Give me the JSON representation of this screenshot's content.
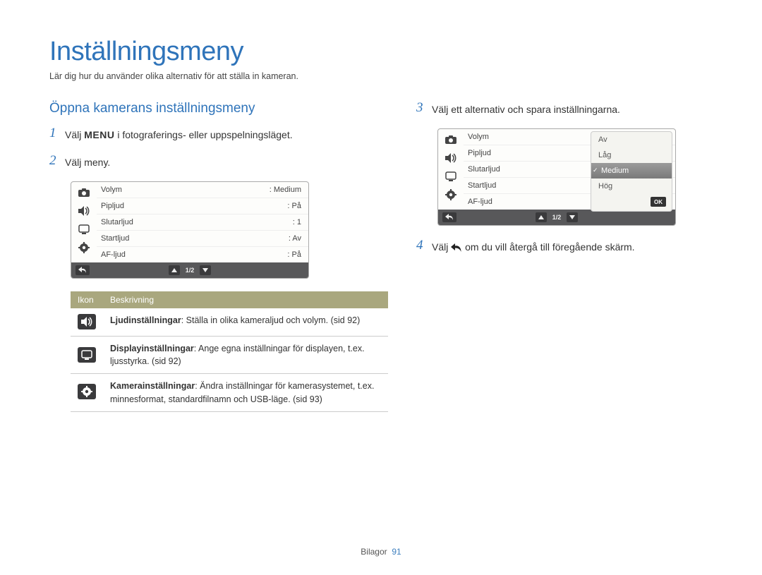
{
  "title": "Inställningsmeny",
  "subtitle": "Lär dig hur du använder olika alternativ för att ställa in kameran.",
  "section_heading": "Öppna kamerans inställningsmeny",
  "steps": {
    "s1_pre": "Välj ",
    "s1_menu": "MENU",
    "s1_post": " i fotograferings- eller uppspelningsläget.",
    "s2": "Välj meny.",
    "s3": "Välj ett alternativ och spara inställningarna.",
    "s4_pre": "Välj ",
    "s4_post": " om du vill återgå till föregående skärm."
  },
  "screen1": {
    "rows": [
      {
        "label": "Volym",
        "value": "Medium"
      },
      {
        "label": "Pipljud",
        "value": "På"
      },
      {
        "label": "Slutarljud",
        "value": "1"
      },
      {
        "label": "Startljud",
        "value": "Av"
      },
      {
        "label": "AF-ljud",
        "value": "På"
      }
    ],
    "page": "1/2"
  },
  "screen2": {
    "rows": [
      {
        "label": "Volym"
      },
      {
        "label": "Pipljud"
      },
      {
        "label": "Slutarljud"
      },
      {
        "label": "Startljud"
      },
      {
        "label": "AF-ljud"
      }
    ],
    "options": [
      "Av",
      "Låg",
      "Medium",
      "Hög"
    ],
    "selected": "Medium",
    "ok": "OK",
    "page": "1/2"
  },
  "table": {
    "head_icon": "Ikon",
    "head_desc": "Beskrivning",
    "rows": [
      {
        "title": "Ljudinställningar",
        "desc": ": Ställa in olika kameraljud och volym. (sid 92)"
      },
      {
        "title": "Displayinställningar",
        "desc": ": Ange egna inställningar för displayen, t.ex. ljusstyrka. (sid 92)"
      },
      {
        "title": "Kamerainställningar",
        "desc": ": Ändra inställningar för kamerasystemet, t.ex. minnesformat, standardfilnamn och USB-läge. (sid 93)"
      }
    ]
  },
  "footer": {
    "label": "Bilagor",
    "page": "91"
  }
}
